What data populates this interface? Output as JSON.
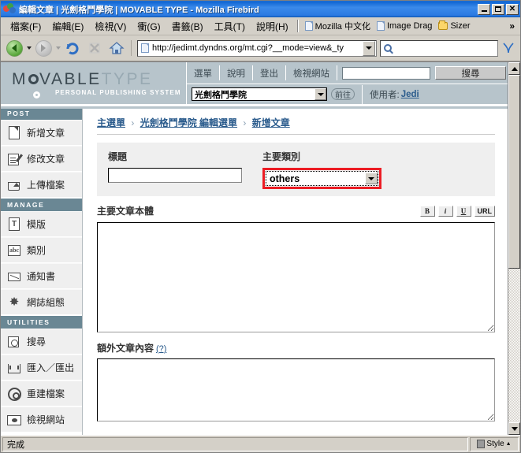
{
  "window": {
    "title": "編輯文章 | 光劍格鬥學院 | MOVABLE TYPE - Mozilla Firebird",
    "minimize_label": "_",
    "maximize_label": "",
    "close_label": "✕"
  },
  "menubar": {
    "items": [
      {
        "label": "檔案(F)",
        "name": "menu-file"
      },
      {
        "label": "編輯(E)",
        "name": "menu-edit"
      },
      {
        "label": "檢視(V)",
        "name": "menu-view"
      },
      {
        "label": "衝(G)",
        "name": "menu-go"
      },
      {
        "label": "書籤(B)",
        "name": "menu-bookmarks"
      },
      {
        "label": "工具(T)",
        "name": "menu-tools"
      },
      {
        "label": "說明(H)",
        "name": "menu-help"
      }
    ],
    "bookmarks": [
      {
        "label": "Mozilla 中文化",
        "icon": "page-icon"
      },
      {
        "label": "Image Drag",
        "icon": "page-icon"
      },
      {
        "label": "Sizer",
        "icon": "folder-icon"
      }
    ],
    "overflow_label": "»"
  },
  "navbar": {
    "back_label": "",
    "forward_label": "",
    "reload_label": "",
    "stop_label": "",
    "home_label": "",
    "url": "http://jedimt.dyndns.org/mt.cgi?__mode=view&_ty",
    "search_placeholder": ""
  },
  "mt_header": {
    "logo_primary": "M",
    "logo_mid": "VABLE",
    "logo_secondary": "TYPE",
    "logo_tagline": "PERSONAL PUBLISHING SYSTEM",
    "nav_links": [
      "選單",
      "說明",
      "登出",
      "檢視網站"
    ],
    "search_value": "",
    "search_button": "搜尋",
    "blog_selected": "光劍格鬥學院",
    "go_button": "前往",
    "user_label": "使用者:",
    "user_name": "Jedi"
  },
  "sidebar": {
    "sections": [
      {
        "heading": "POST",
        "items": [
          {
            "label": "新增文章",
            "icon": "new-post-icon",
            "shape": "i-doc"
          },
          {
            "label": "修改文章",
            "icon": "edit-post-icon",
            "shape": "i-edit"
          },
          {
            "label": "上傳檔案",
            "icon": "upload-file-icon",
            "shape": "i-upload"
          }
        ]
      },
      {
        "heading": "MANAGE",
        "items": [
          {
            "label": "模版",
            "icon": "template-icon",
            "shape": "i-tmpl",
            "glyph": "T"
          },
          {
            "label": "類別",
            "icon": "category-icon",
            "shape": "i-cat",
            "glyph": "abc"
          },
          {
            "label": "通知書",
            "icon": "notification-icon",
            "shape": "i-mail"
          },
          {
            "label": "網誌組態",
            "icon": "blog-config-icon",
            "shape": "i-tools",
            "glyph": "✸"
          }
        ]
      },
      {
        "heading": "UTILITIES",
        "items": [
          {
            "label": "搜尋",
            "icon": "search-icon",
            "shape": "i-search"
          },
          {
            "label": "匯入／匯出",
            "icon": "import-export-icon",
            "shape": "i-imex"
          },
          {
            "label": "重建檔案",
            "icon": "rebuild-icon",
            "shape": "i-rebuild"
          },
          {
            "label": "檢視網站",
            "icon": "view-site-icon",
            "shape": "i-view"
          }
        ]
      }
    ]
  },
  "main": {
    "breadcrumb": {
      "root": "主選單",
      "sep": "›",
      "mid": "光劍格鬥學院 編輯選單",
      "current": "新增文章"
    },
    "title_field": {
      "label": "標題",
      "value": "",
      "placeholder": ""
    },
    "category_field": {
      "label": "主要類別",
      "selected": "others",
      "highlight_color": "#ec1c24"
    },
    "body_field": {
      "label": "主要文章本體",
      "value": "",
      "format_buttons": [
        "B",
        "i",
        "U",
        "URL"
      ]
    },
    "extended_field": {
      "label": "額外文章內容",
      "help": "(?)",
      "value": ""
    }
  },
  "statusbar": {
    "message": "完成",
    "style_label": "Style",
    "style_caret": "▲"
  }
}
